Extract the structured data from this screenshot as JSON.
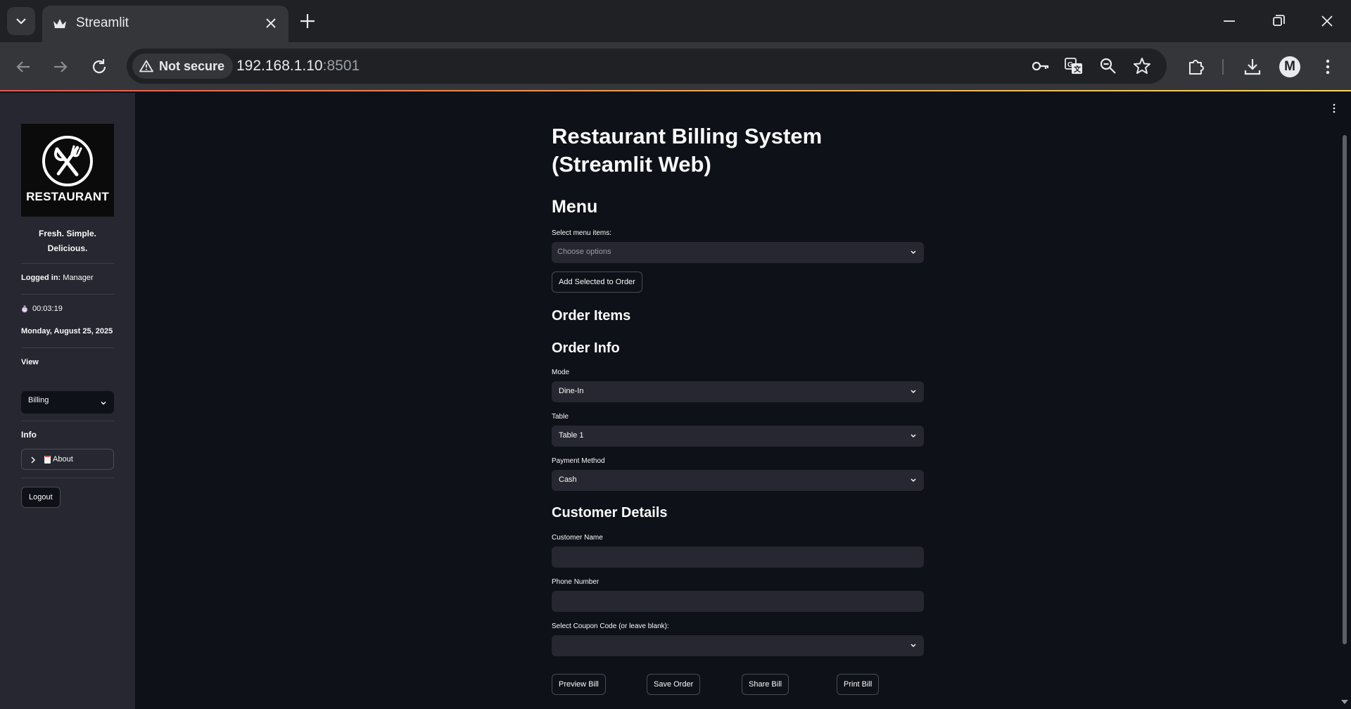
{
  "browser": {
    "tab_title": "Streamlit",
    "security_label": "Not secure",
    "url_host": "192.168.1.10",
    "url_port": ":8501",
    "profile_initial": "M"
  },
  "sidebar": {
    "logo_text": "RESTAURANT",
    "tagline": "Fresh. Simple. Delicious.",
    "logged_in_label": "Logged in:",
    "logged_in_user": "Manager",
    "timer": "00:03:19",
    "date": "Monday, August 25, 2025",
    "view_heading": "View",
    "view_selected": "Billing",
    "info_heading": "Info",
    "about_label": "About",
    "logout_label": "Logout"
  },
  "main": {
    "title": "Restaurant Billing System (Streamlit Web)",
    "menu_heading": "Menu",
    "menu_select_label": "Select menu items:",
    "menu_select_placeholder": "Choose options",
    "add_button": "Add Selected to Order",
    "order_items_heading": "Order Items",
    "order_info_heading": "Order Info",
    "mode_label": "Mode",
    "mode_value": "Dine-In",
    "table_label": "Table",
    "table_value": "Table 1",
    "payment_label": "Payment Method",
    "payment_value": "Cash",
    "customer_heading": "Customer Details",
    "customer_name_label": "Customer Name",
    "customer_name_value": "",
    "phone_label": "Phone Number",
    "phone_value": "",
    "coupon_label": "Select Coupon Code (or leave blank):",
    "coupon_value": "",
    "buttons": {
      "preview": "Preview Bill",
      "save": "Save Order",
      "share": "Share Bill",
      "print": "Print Bill"
    }
  },
  "colors": {
    "app_bg": "#0e1117",
    "sidebar_bg": "#262730",
    "input_bg": "#262730",
    "chrome_bg": "#202124",
    "chrome_toolbar": "#35363a"
  }
}
